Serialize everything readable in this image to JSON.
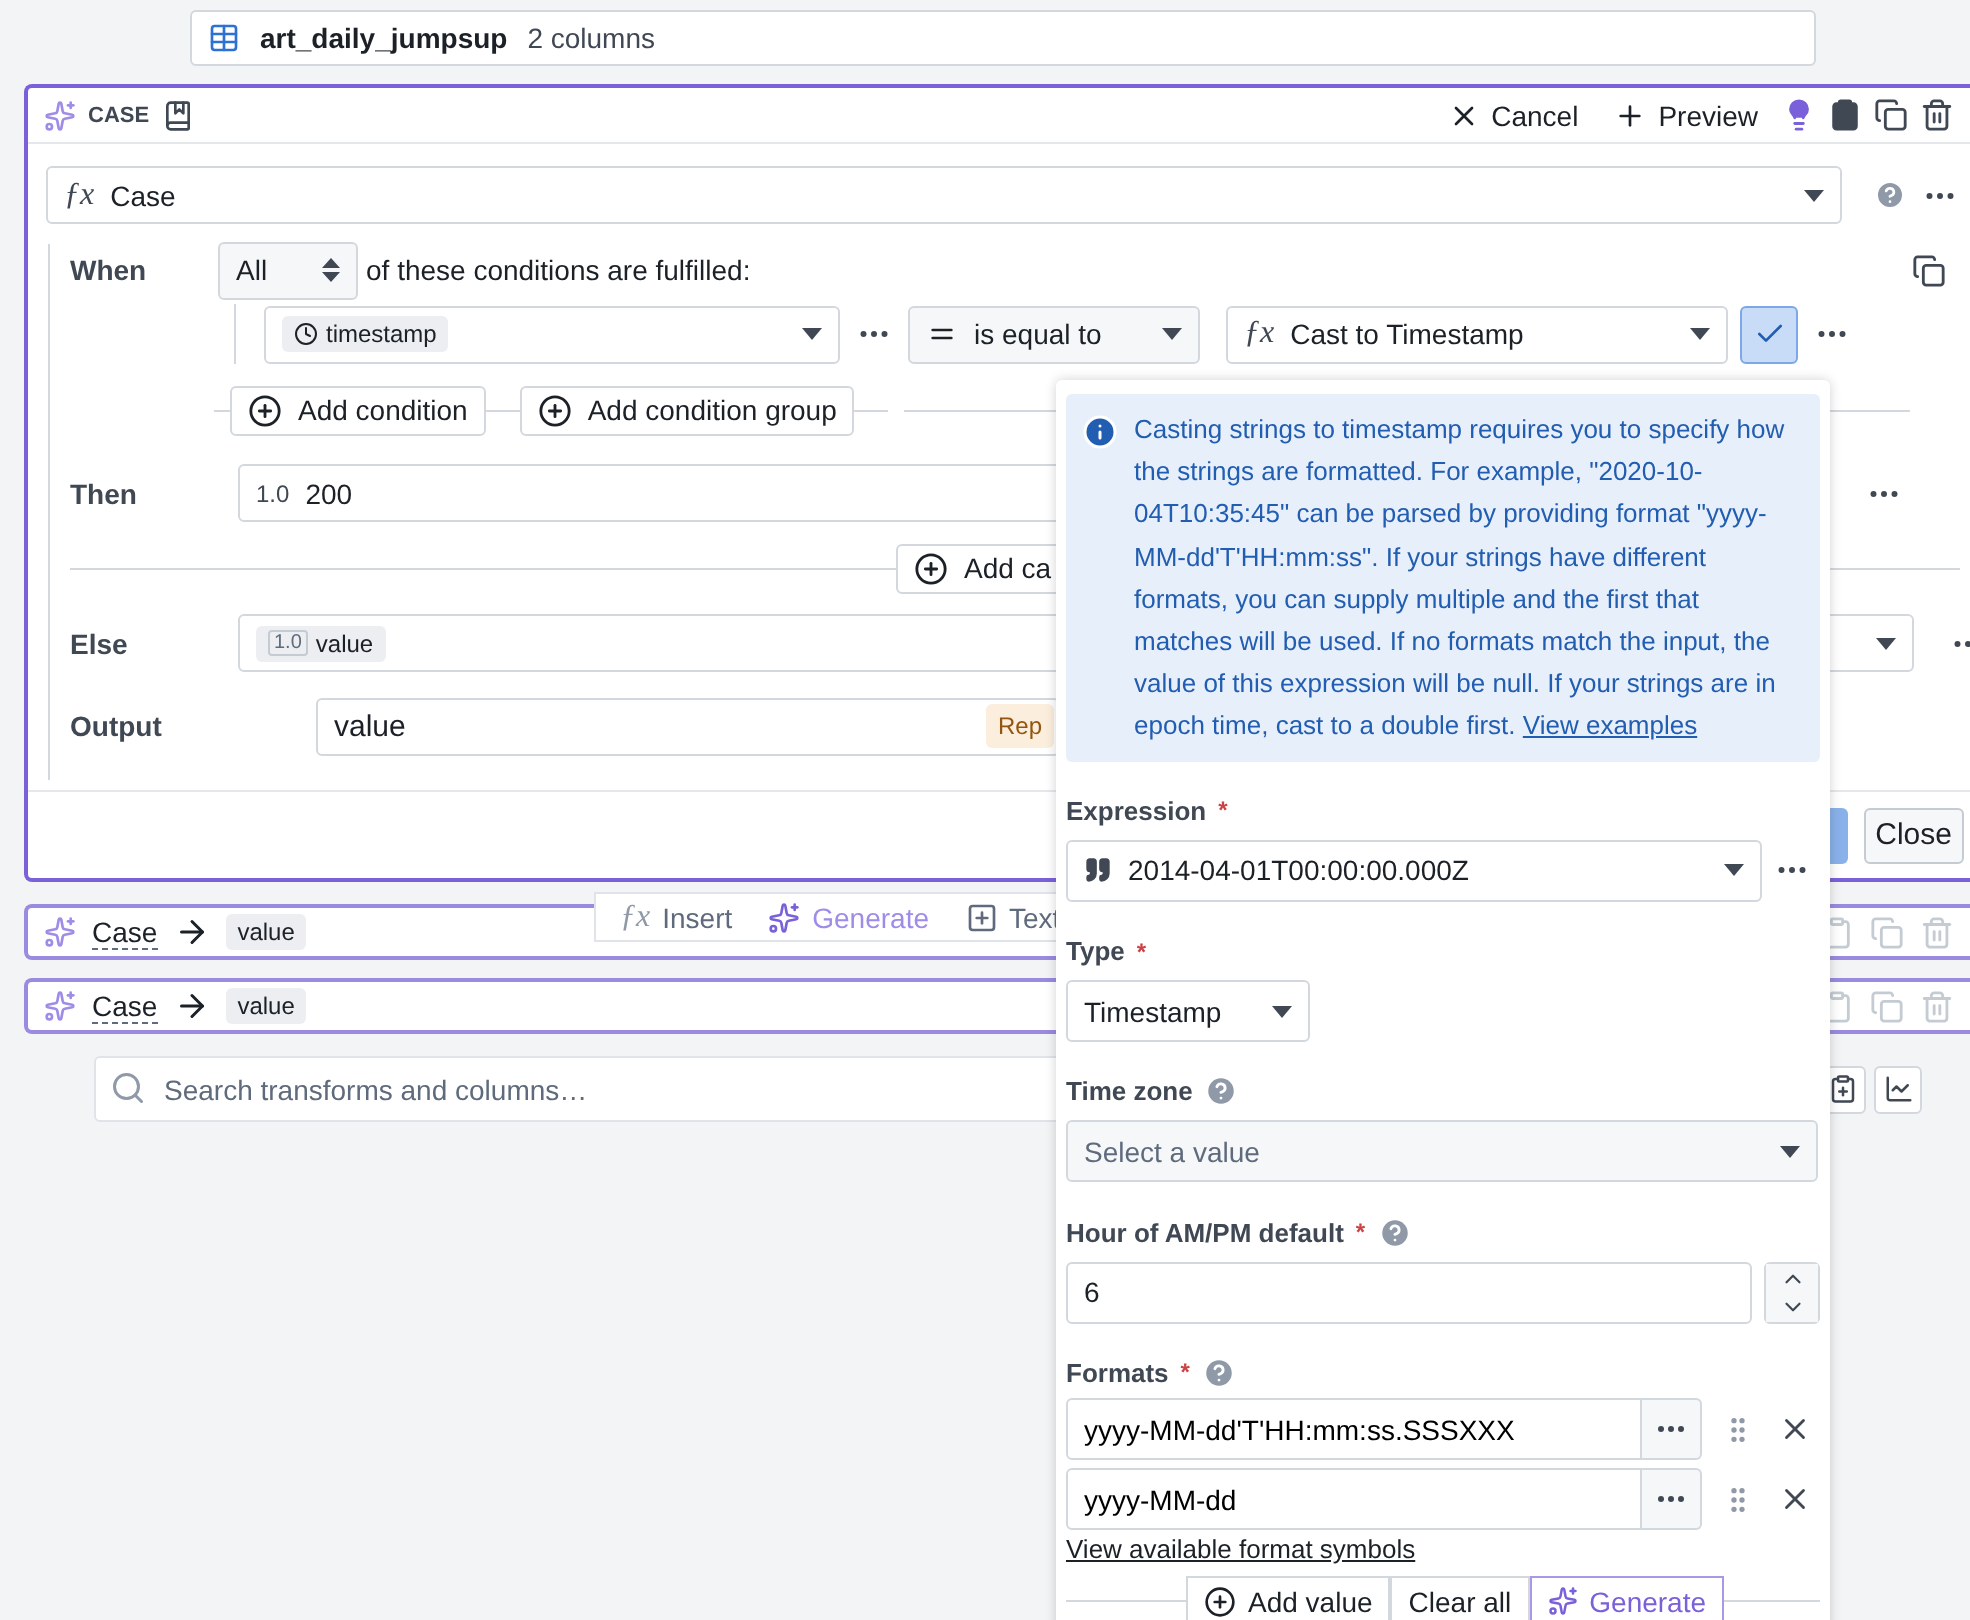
{
  "dataset": {
    "name": "art_daily_jumpsup",
    "columns": "2 columns"
  },
  "board": {
    "label": "CASE",
    "actions": [
      {
        "kind": "cancel",
        "label": "Cancel"
      },
      {
        "kind": "preview",
        "label": "Preview"
      }
    ],
    "function": {
      "icon": "ƒx",
      "label": "Case"
    },
    "when": {
      "label": "When",
      "quantifier": "All",
      "suffix": "of these conditions are fulfilled:"
    },
    "condition": {
      "column": "timestamp",
      "operator": "is equal to",
      "value_icon": "ƒx",
      "value": "Cast to Timestamp",
      "confirmed": true
    },
    "add_buttons": [
      "Add condition",
      "Add condition group"
    ],
    "then": {
      "label": "Then",
      "type": "1.0",
      "value": "200"
    },
    "add_case": "Add ca",
    "else": {
      "label": "Else",
      "type": "1.0",
      "value": "value"
    },
    "output": {
      "label": "Output",
      "value": "value",
      "badge": "Rep"
    },
    "close": "Close"
  },
  "insert_toolbar": [
    {
      "kind": "fx",
      "icon": "ƒx",
      "label": "Insert"
    },
    {
      "kind": "generate",
      "label": "Generate"
    },
    {
      "kind": "text",
      "label": "Text"
    }
  ],
  "collapsed": [
    {
      "label": "Case",
      "output": "value"
    },
    {
      "label": "Case",
      "output": "value"
    }
  ],
  "search": {
    "placeholder": "Search transforms and columns…"
  },
  "popover": {
    "info": "Casting strings to timestamp requires you to specify how the strings are formatted. For example, \"2020-10-04T10:35:45\" can be parsed by providing format \"yyyy-MM-dd'T'HH:mm:ss\". If your strings have different formats, you can supply multiple and the first that matches will be used. If no formats match the input, the value of this expression will be null. If your strings are in epoch time, cast to a double first.",
    "info_link": "View examples",
    "expression": {
      "label": "Expression",
      "required_mark": "*",
      "value": "2014-04-01T00:00:00.000Z"
    },
    "type": {
      "label": "Type",
      "required_mark": "*",
      "value": "Timestamp"
    },
    "timezone": {
      "label": "Time zone",
      "help": true,
      "placeholder": "Select a value"
    },
    "hour": {
      "label": "Hour of AM/PM default",
      "required_mark": "*",
      "help": true,
      "value": "6"
    },
    "formats": {
      "label": "Formats",
      "required_mark": "*",
      "help": true,
      "values": [
        "yyyy-MM-dd'T'HH:mm:ss.SSSXXX",
        "yyyy-MM-dd"
      ],
      "link": "View available format symbols",
      "actions": [
        {
          "kind": "add",
          "label": "Add value"
        },
        {
          "kind": "clear",
          "label": "Clear all"
        },
        {
          "kind": "generate",
          "label": "Generate"
        }
      ]
    }
  }
}
